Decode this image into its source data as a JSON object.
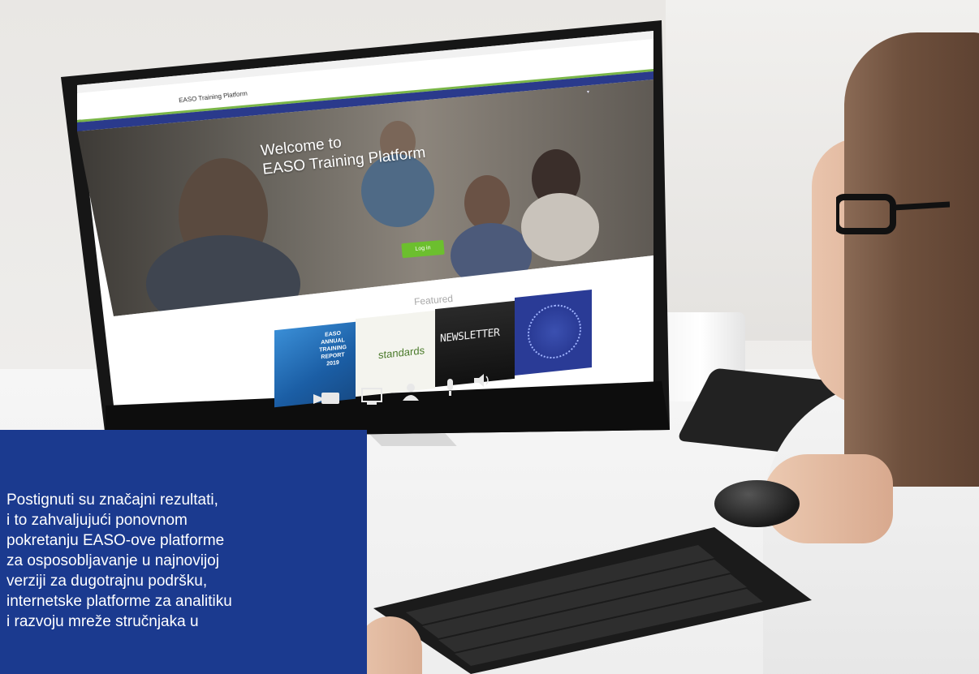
{
  "screen": {
    "site_name": "EASO Training Platform",
    "hero_title_line1": "Welcome to",
    "hero_title_line2": "EASO Training Platform",
    "login_button": "Log in",
    "featured_heading": "Featured",
    "featured_tiles": [
      {
        "name": "annual-training-report",
        "lines": [
          "EASO",
          "ANNUAL",
          "TRAINING",
          "REPORT",
          "2019"
        ]
      },
      {
        "name": "standards-word-cloud",
        "words": [
          "standards"
        ]
      },
      {
        "name": "newsletter",
        "label": "NEWSLETTER"
      },
      {
        "name": "circular-emblem"
      }
    ],
    "taskbar_icons": [
      "video-camera-icon",
      "monitor-icon",
      "person-icon",
      "microphone-icon",
      "speaker-icon"
    ]
  },
  "caption": {
    "text": "Postignuti su značajni rezultati,\ni to zahvaljujući ponovnom\npokretanju EASO-ove platforme\nza osposobljavanje u najnovijoj\nverziji za dugotrajnu podršku,\ninternetske platforme za analitiku\ni razvoju mreže stručnjaka u"
  },
  "colors": {
    "caption_background": "#1b3a8f",
    "site_header_bar": "#2a3a8c",
    "login_button": "#6cbf2e",
    "accent_green_line": "#7ab648"
  }
}
